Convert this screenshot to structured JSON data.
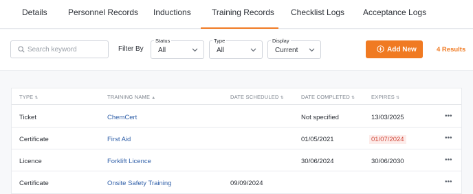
{
  "tabs": [
    {
      "label": "Details"
    },
    {
      "label": "Personnel Records"
    },
    {
      "label": "Inductions"
    },
    {
      "label": "Training Records"
    },
    {
      "label": "Checklist Logs"
    },
    {
      "label": "Acceptance Logs"
    }
  ],
  "active_tab": "Training Records",
  "filters": {
    "search_placeholder": "Search keyword",
    "filter_by_label": "Filter By",
    "status": {
      "label": "Status",
      "value": "All"
    },
    "type": {
      "label": "Type",
      "value": "All"
    },
    "display": {
      "label": "Display",
      "value": "Current"
    }
  },
  "add_button": {
    "label": "Add New"
  },
  "results_count": "4 Results",
  "table": {
    "columns": [
      "TYPE",
      "TRAINING NAME",
      "DATE SCHEDULED",
      "DATE COMPLETED",
      "EXPIRES"
    ],
    "rows": [
      {
        "type": "Ticket",
        "name": "ChemCert",
        "scheduled": "",
        "completed": "Not specified",
        "expires": "13/03/2025",
        "expired": false
      },
      {
        "type": "Certificate",
        "name": "First Aid",
        "scheduled": "",
        "completed": "01/05/2021",
        "expires": "01/07/2024",
        "expired": true
      },
      {
        "type": "Licence",
        "name": "Forklift Licence",
        "scheduled": "",
        "completed": "30/06/2024",
        "expires": "30/06/2030",
        "expired": false
      },
      {
        "type": "Certificate",
        "name": "Onsite Safety Training",
        "scheduled": "09/09/2024",
        "completed": "",
        "expires": "",
        "expired": false
      }
    ],
    "row_menu_label": "•••"
  },
  "colors": {
    "accent": "#f07a22",
    "link": "#2f5fa8",
    "expired_text": "#d0483a",
    "expired_bg": "#fdecea"
  },
  "icons": {
    "search": "search-icon",
    "chevron": "chevron-down-icon",
    "add": "plus-circle-icon",
    "sort": "sort-icon",
    "sort_asc": "sort-asc-icon",
    "more": "more-horizontal-icon"
  }
}
